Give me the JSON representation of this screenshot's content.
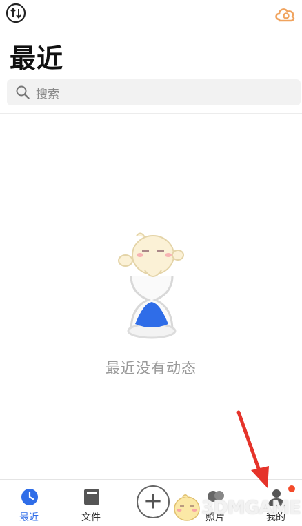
{
  "header": {
    "title": "最近",
    "transfer_icon": "transfer-icon",
    "cloud_icon": "cloud-icon"
  },
  "search": {
    "placeholder": "搜索",
    "icon": "search-icon"
  },
  "empty_state": {
    "message": "最近没有动态",
    "illustration": "hourglass-mascot-illustration"
  },
  "bottom_nav": {
    "items": [
      {
        "label": "最近",
        "icon": "clock-icon",
        "active": true
      },
      {
        "label": "文件",
        "icon": "folder-icon",
        "active": false
      },
      {
        "label": "",
        "icon": "plus-icon",
        "active": false
      },
      {
        "label": "照片",
        "icon": "photo-icon",
        "active": false
      },
      {
        "label": "我的",
        "icon": "person-icon",
        "active": false,
        "badge": true
      }
    ]
  },
  "watermark": {
    "text": "3DMGAME"
  },
  "colors": {
    "accent": "#2f6de8",
    "cloud": "#f0a35e",
    "badge": "#f34a2a",
    "arrow": "#e5332a",
    "search_bg": "#f2f2f2"
  }
}
